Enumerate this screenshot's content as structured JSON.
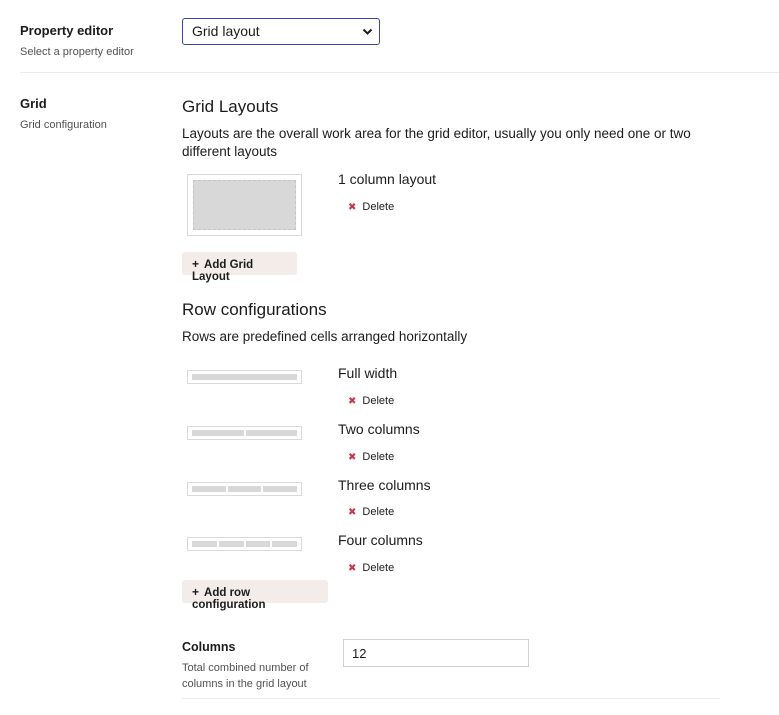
{
  "property_editor": {
    "label": "Property editor",
    "description": "Select a property editor",
    "selected": "Grid layout"
  },
  "grid": {
    "label": "Grid",
    "description": "Grid configuration"
  },
  "grid_layouts": {
    "heading": "Grid Layouts",
    "description": "Layouts are the overall work area for the grid editor, usually you only need one or two different layouts",
    "items": [
      {
        "name": "1 column layout",
        "delete_label": "Delete"
      }
    ],
    "add_label": "Add Grid Layout"
  },
  "row_configurations": {
    "heading": "Row configurations",
    "description": "Rows are predefined cells arranged horizontally",
    "items": [
      {
        "name": "Full width",
        "delete_label": "Delete",
        "cells": 1
      },
      {
        "name": "Two columns",
        "delete_label": "Delete",
        "cells": 2
      },
      {
        "name": "Three columns",
        "delete_label": "Delete",
        "cells": 3
      },
      {
        "name": "Four columns",
        "delete_label": "Delete",
        "cells": 4
      }
    ],
    "add_label": "Add row configuration"
  },
  "columns": {
    "label": "Columns",
    "description_line1": "Total combined number of",
    "description_line2": "columns in the grid layout",
    "value": "12"
  },
  "icons": {
    "delete": "x-icon",
    "add": "plus-icon",
    "select": "chevron-down-icon"
  },
  "colors": {
    "delete_x": "#c8384c",
    "select_border": "#3544b1",
    "button_bg": "#f3ece8"
  }
}
